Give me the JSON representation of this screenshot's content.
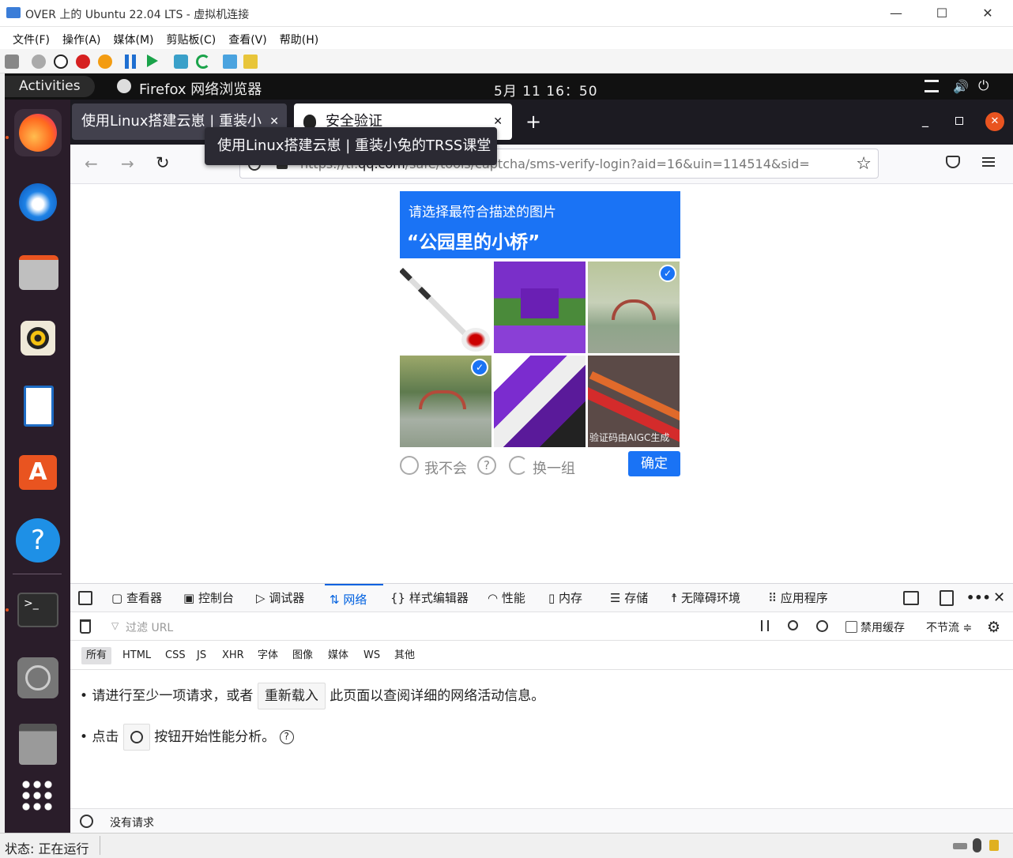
{
  "window": {
    "title": "OVER 上的 Ubuntu 22.04 LTS - 虚拟机连接",
    "min": "—",
    "max": "☐",
    "close": "✕"
  },
  "menu": [
    "文件(F)",
    "操作(A)",
    "媒体(M)",
    "剪贴板(C)",
    "查看(V)",
    "帮助(H)"
  ],
  "gnome": {
    "activities": "Activities",
    "app": "Firefox 网络浏览器",
    "clock": "5月 11  16：50"
  },
  "firefox": {
    "tab1": "使用Linux搭建云崽 | 重装小",
    "tab2": "安全验证",
    "tooltip": "使用Linux搭建云崽 | 重装小兔的TRSS课堂",
    "url_prefix": "https://ti.",
    "url_domain": "qq.com",
    "url_path": "/safe/tools/captcha/sms-verify-login?aid=16&uin=114514&sid="
  },
  "captcha": {
    "instruction": "请选择最符合描述的图片",
    "prompt": "“公园里的小桥”",
    "watermark": "验证码由AIGC生成",
    "dont_know": "我不会",
    "help": "?",
    "refresh": "换一组",
    "confirm": "确定",
    "selected": [
      false,
      false,
      true,
      true,
      false,
      false
    ]
  },
  "devtools": {
    "tabs": [
      "查看器",
      "控制台",
      "调试器",
      "网络",
      "样式编辑器",
      "性能",
      "内存",
      "存储",
      "无障碍环境",
      "应用程序"
    ],
    "filter_placeholder": "过滤 URL",
    "disable_cache": "禁用缓存",
    "throttle": "不节流 ≑",
    "types": [
      "所有",
      "HTML",
      "CSS",
      "JS",
      "XHR",
      "字体",
      "图像",
      "媒体",
      "WS",
      "其他"
    ],
    "msg1_pre": "• 请进行至少一项请求，或者",
    "msg1_btn": "重新载入",
    "msg1_post": "此页面以查阅详细的网络活动信息。",
    "msg2_pre": "• 点击",
    "msg2_post": "按钮开始性能分析。",
    "footer": "没有请求"
  },
  "statusbar": {
    "text": "状态: 正在运行"
  }
}
